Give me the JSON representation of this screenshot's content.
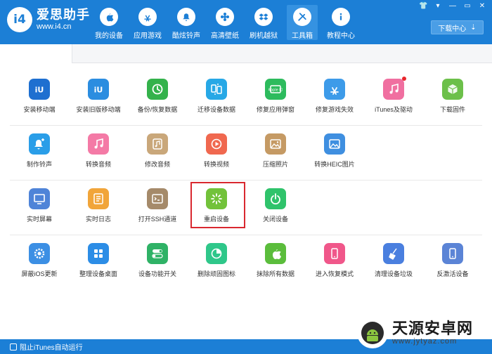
{
  "app": {
    "name": "爱思助手",
    "url": "www.i4.cn",
    "logo_text": "i4"
  },
  "nav": [
    {
      "label": "我的设备",
      "icon": "apple-icon"
    },
    {
      "label": "应用游戏",
      "icon": "app-store-icon"
    },
    {
      "label": "酷炫铃声",
      "icon": "bell-icon"
    },
    {
      "label": "高清壁纸",
      "icon": "flower-icon"
    },
    {
      "label": "刷机越狱",
      "icon": "dropbox-icon"
    },
    {
      "label": "工具箱",
      "icon": "tools-icon",
      "active": true
    },
    {
      "label": "教程中心",
      "icon": "info-icon"
    }
  ],
  "window": {
    "download_label": "下载中心"
  },
  "tools": {
    "row1": [
      {
        "label": "安装移动端",
        "color": "#1e6fd0",
        "icon": "i4-icon"
      },
      {
        "label": "安装旧版移动端",
        "color": "#2b8de0",
        "icon": "i4-icon"
      },
      {
        "label": "备份/恢复数据",
        "color": "#34b24b",
        "icon": "clock-icon"
      },
      {
        "label": "迁移设备数据",
        "color": "#27a8e6",
        "icon": "transfer-icon"
      },
      {
        "label": "修复应用弹窗",
        "color": "#2dbb5d",
        "icon": "appid-icon"
      },
      {
        "label": "修复游戏失效",
        "color": "#3d9be9",
        "icon": "app-store-icon"
      },
      {
        "label": "iTunes及驱动",
        "color": "#f06fa0",
        "icon": "music-icon",
        "badge": true
      },
      {
        "label": "下载固件",
        "color": "#6cc04a",
        "icon": "cube-icon"
      }
    ],
    "row2": [
      {
        "label": "制作铃声",
        "color": "#2a9ee8",
        "icon": "bell-add-icon"
      },
      {
        "label": "转换音频",
        "color": "#f47aa6",
        "icon": "music-icon"
      },
      {
        "label": "修改音频",
        "color": "#c9a77a",
        "icon": "music-edit-icon"
      },
      {
        "label": "转换视频",
        "color": "#f0684f",
        "icon": "play-icon"
      },
      {
        "label": "压缩照片",
        "color": "#c59a64",
        "icon": "image-icon"
      },
      {
        "label": "转换HEIC图片",
        "color": "#3f8fe0",
        "icon": "image-convert-icon"
      }
    ],
    "row3": [
      {
        "label": "实时屏幕",
        "color": "#4f84d8",
        "icon": "monitor-icon"
      },
      {
        "label": "实时日志",
        "color": "#f1a53a",
        "icon": "log-icon"
      },
      {
        "label": "打开SSH通道",
        "color": "#a58a6a",
        "icon": "terminal-icon"
      },
      {
        "label": "重启设备",
        "color": "#72c23a",
        "icon": "restart-icon"
      },
      {
        "label": "关闭设备",
        "color": "#2fc36b",
        "icon": "power-icon"
      }
    ],
    "row4": [
      {
        "label": "屏蔽iOS更新",
        "color": "#3c8fe4",
        "icon": "gear-icon"
      },
      {
        "label": "整理设备桌面",
        "color": "#2c8de6",
        "icon": "grid-icon"
      },
      {
        "label": "设备功能开关",
        "color": "#2fb266",
        "icon": "toggle-icon"
      },
      {
        "label": "删除顽固图标",
        "color": "#2fc78a",
        "icon": "pie-icon"
      },
      {
        "label": "抹除所有数据",
        "color": "#5bbd3c",
        "icon": "apple-icon"
      },
      {
        "label": "进入恢复模式",
        "color": "#f0578a",
        "icon": "phone-icon"
      },
      {
        "label": "清理设备垃圾",
        "color": "#4a7fdf",
        "icon": "broom-icon"
      },
      {
        "label": "反激活设备",
        "color": "#5b84d6",
        "icon": "phone-icon"
      }
    ]
  },
  "footer": {
    "itunes_label": "阻止iTunes自动运行"
  },
  "watermark": {
    "name": "天源安卓网",
    "url": "www.jytyaz.com"
  }
}
